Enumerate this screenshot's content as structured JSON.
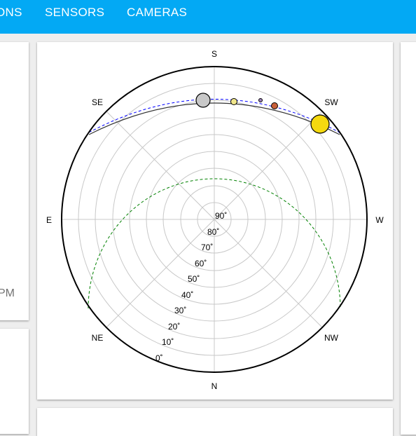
{
  "tabs": [
    "ONS",
    "SENSORS",
    "CAMERAS"
  ],
  "left_card": {
    "time_fragment": "PM"
  },
  "sky_chart": {
    "directions": {
      "top": "S",
      "bottom": "N",
      "left": "E",
      "right": "W",
      "upper_left": "SE",
      "upper_right": "SW",
      "lower_left": "NE",
      "lower_right": "NW"
    },
    "altitude_labels": [
      "90˚",
      "80˚",
      "70˚",
      "60˚",
      "50˚",
      "40˚",
      "30˚",
      "20˚",
      "10˚",
      "0˚"
    ],
    "colors": {
      "accent": "#03a9f4",
      "ecliptic": "#0000ff",
      "horizon_path": "#008000",
      "sun": "#f5d90f",
      "moon": "#c8c8c8",
      "planet_yellow": "#f0e68c",
      "planet_red": "#c8603a",
      "planet_violet": "#9b7fb8"
    }
  }
}
